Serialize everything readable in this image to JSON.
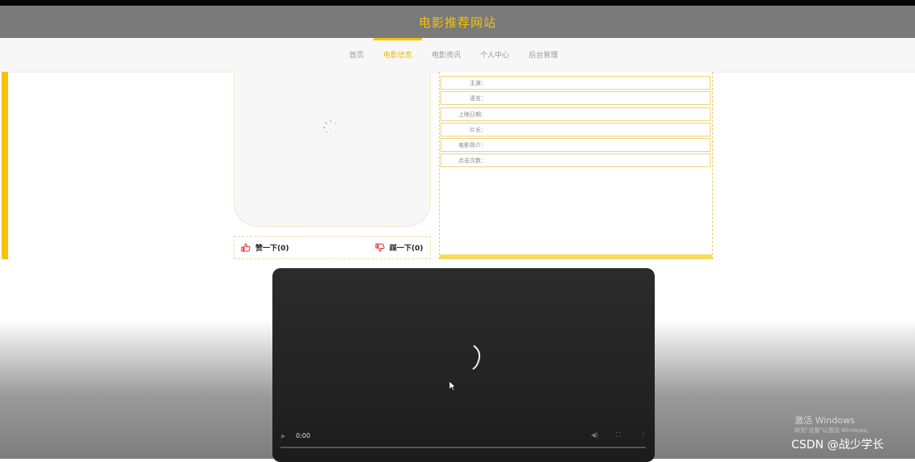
{
  "header": {
    "title": "电影推荐网站"
  },
  "nav": {
    "items": [
      {
        "label": "首页",
        "active": false
      },
      {
        "label": "电影信息",
        "active": true
      },
      {
        "label": "电影资讯",
        "active": false
      },
      {
        "label": "个人中心",
        "active": false
      },
      {
        "label": "后台管理",
        "active": false
      }
    ]
  },
  "votes": {
    "up": "赞一下(0)",
    "down": "踩一下(0)"
  },
  "info": {
    "rows": [
      "主演：",
      "语言：",
      "上映日期：",
      "片长：",
      "电影简介：",
      "点击次数："
    ]
  },
  "video": {
    "time": "0:00"
  },
  "overlay": {
    "windows_activate": "激活 Windows",
    "windows_activate_sub": "转到\"设置\"以激活 Windows。",
    "watermark": "CSDN @战少学长"
  },
  "colors": {
    "accent": "#f7c200",
    "header_bg": "#7a7a7a",
    "vote_icon": "#e0302a"
  },
  "icons": {
    "vote_up": "thumbs-up-icon",
    "vote_down": "thumbs-down-icon",
    "video_play": "play-icon",
    "video_volume": "volume-icon",
    "video_fullscreen": "fullscreen-icon",
    "video_menu": "more-options-icon"
  }
}
